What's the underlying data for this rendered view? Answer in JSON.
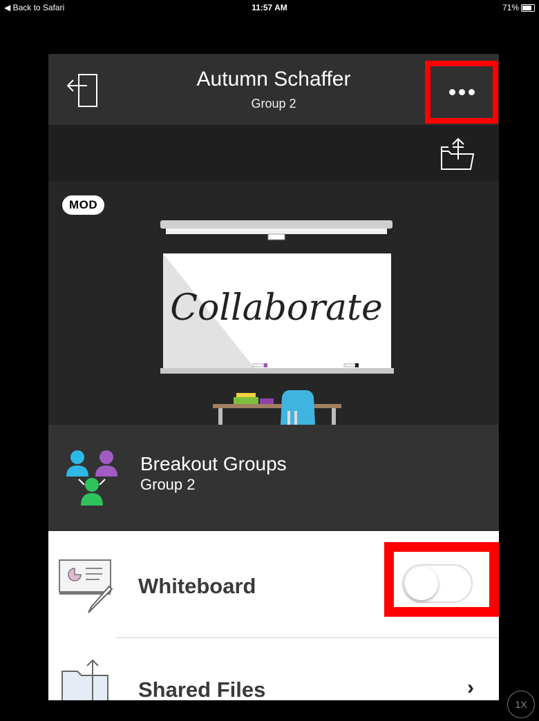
{
  "status_bar": {
    "back_label": "◀ Back to Safari",
    "time": "11:57 AM",
    "battery": "71%"
  },
  "header": {
    "title": "Autumn Schaffer",
    "subtitle": "Group 2",
    "exit_icon": "exit-icon",
    "more_icon": "more-options-icon"
  },
  "toolbar": {
    "share_icon": "share-file-icon"
  },
  "stage": {
    "badge": "MOD",
    "whiteboard_text": "Collaborate"
  },
  "breakout": {
    "title": "Breakout Groups",
    "subtitle": "Group 2",
    "icon": "breakout-groups-icon"
  },
  "list": {
    "whiteboard_label": "Whiteboard",
    "whiteboard_toggle_on": false,
    "shared_files_label": "Shared Files",
    "chevron": "›"
  },
  "playback": {
    "speed": "1X"
  },
  "colors": {
    "highlight": "#ff0000",
    "header_bg": "#303030",
    "panel_bg": "#262626"
  }
}
